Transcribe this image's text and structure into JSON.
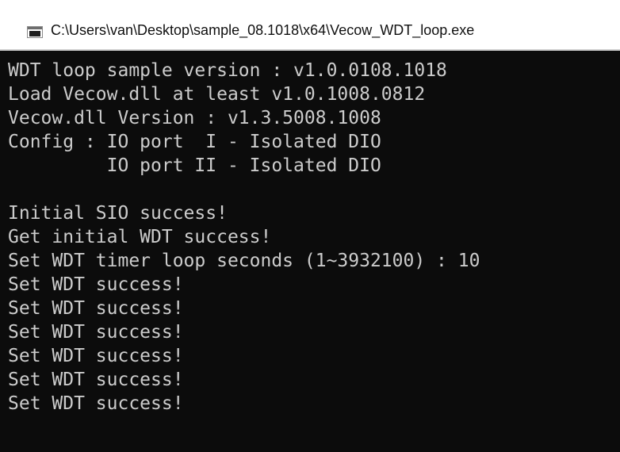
{
  "window": {
    "title": "C:\\Users\\van\\Desktop\\sample_08.1018\\x64\\Vecow_WDT_loop.exe",
    "icon": "console-window-icon",
    "colors": {
      "titlebar_bg": "#ffffff",
      "console_bg": "#0c0c0c",
      "console_text": "#cccccc"
    }
  },
  "console": {
    "lines": [
      "WDT loop sample version : v1.0.0108.1018",
      "Load Vecow.dll at least v1.0.1008.0812",
      "Vecow.dll Version : v1.3.5008.1008",
      "Config : IO port  I - Isolated DIO",
      "         IO port II - Isolated DIO",
      "",
      "Initial SIO success!",
      "Get initial WDT success!",
      "Set WDT timer loop seconds (1~3932100) : 10",
      "Set WDT success!",
      "Set WDT success!",
      "Set WDT success!",
      "Set WDT success!",
      "Set WDT success!",
      "Set WDT success!"
    ]
  }
}
